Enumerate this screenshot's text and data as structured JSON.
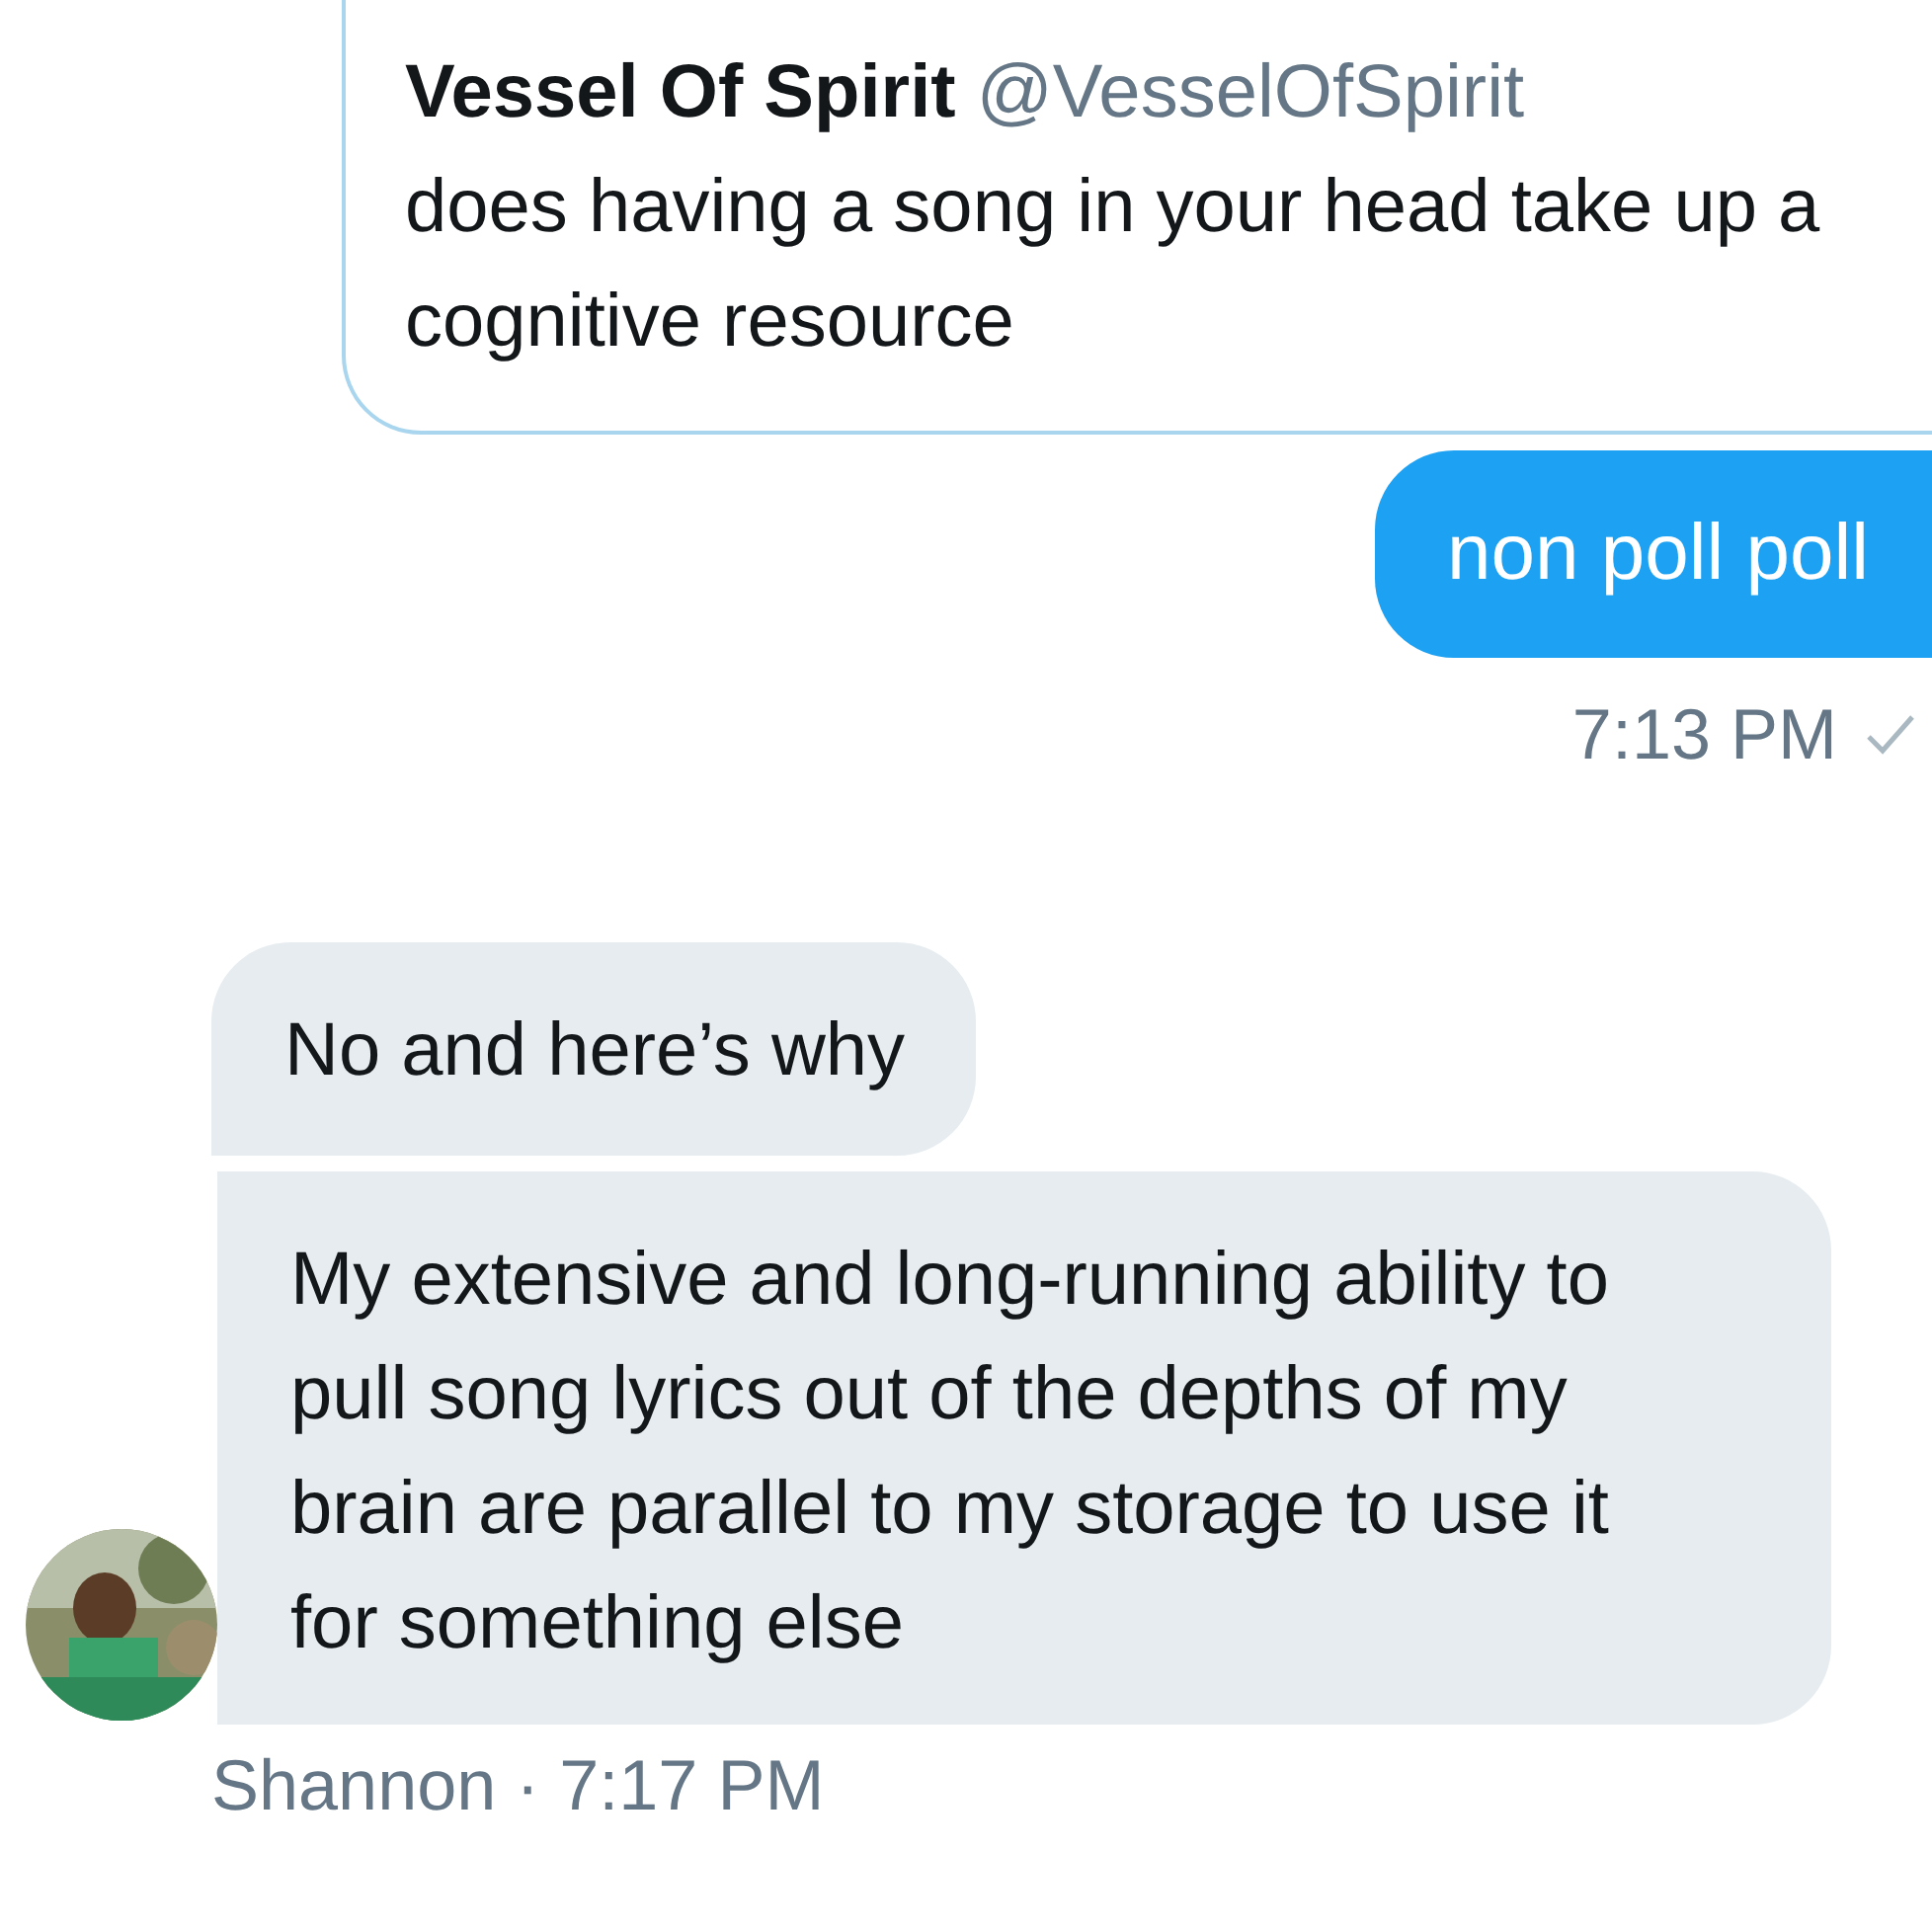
{
  "quoted_tweet": {
    "name": "Vessel Of Spirit",
    "handle": "@VesselOfSpirit",
    "text": "does having a song in your head take up a cognitive resource"
  },
  "sent_message": {
    "text": "non poll poll",
    "time": "7:13 PM"
  },
  "received_messages": [
    {
      "text": "No and here’s why"
    },
    {
      "text": "My extensive and long-running ability to pull song lyrics out of the depths of my brain are parallel to my storage to use it for something else"
    }
  ],
  "received_footer": "Shannon · 7:17 PM"
}
